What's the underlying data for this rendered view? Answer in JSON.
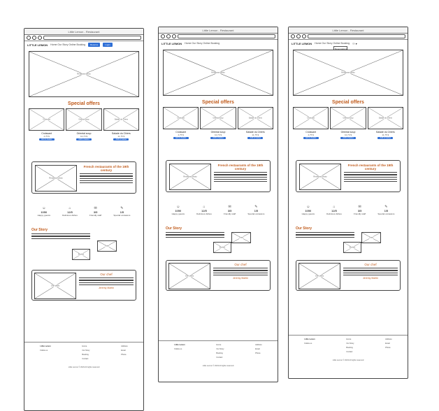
{
  "window_title": "Little Lemon - Restaurant",
  "nav": {
    "logo": "LITTLE LEMON",
    "links": "Home   Our Story   Online Booking",
    "button1": "Reserve",
    "button2": "Login",
    "dropdown": [
      "Reservations",
      "Account"
    ]
  },
  "hero": {
    "placeholder": "Restaurant photo"
  },
  "offers": {
    "title": "Special offers",
    "items": [
      {
        "name": "Croissant",
        "price": "4,75 $",
        "button": "Add to basket",
        "img": "Croissant"
      },
      {
        "name": "Oriental soup",
        "price": "10,70 $",
        "button": "Add to basket",
        "img": "Oriental soup"
      },
      {
        "name": "Salade du Chiers",
        "price": "11,75 $",
        "button": "Add to basket",
        "img": "Salade du Chiers"
      }
    ]
  },
  "restaurant": {
    "title": "French restaurants of the 19th century",
    "img": "Restaurant photo"
  },
  "stats": [
    {
      "icon": "☺",
      "value": "1050",
      "label": "Happy guests"
    },
    {
      "icon": "⌂",
      "value": "12/5",
      "label": "Delicious dishes"
    },
    {
      "icon": "✉",
      "value": "3/5",
      "label": "Friendly staff"
    },
    {
      "icon": "✎",
      "value": "1/5",
      "label": "Special occasions"
    }
  ],
  "story": {
    "title": "Our Story",
    "img1": "Team",
    "img2": "Kitchen"
  },
  "chef": {
    "title": "Our chef",
    "name": "Jeremy Martin",
    "img": "Chef photo"
  },
  "footer": {
    "col1": [
      "Little Lemon",
      "Follow us"
    ],
    "col2": [
      "Home",
      "Our Story",
      "Booking",
      "Contact"
    ],
    "col3": [
      "Address",
      "Email",
      "Phone"
    ],
    "copyright": "Little Lemon © 2023 All rights reserved"
  }
}
